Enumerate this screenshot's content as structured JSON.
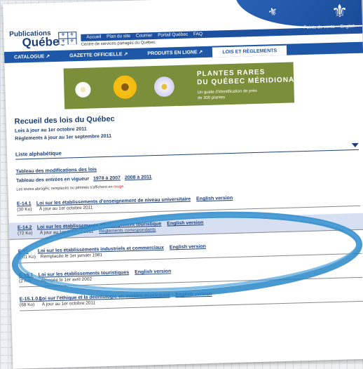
{
  "header": {
    "logo_line1": "Publications",
    "logo_line2": "Québec",
    "subtitle": "Centre de services partagés du Québec",
    "top_nav": [
      "Accueil",
      "Plan du site",
      "Courrier",
      "Portail Québec",
      "FAQ"
    ],
    "top_right": [
      "Points de vente",
      "English"
    ]
  },
  "tabs": [
    "CATALOGUE ↗",
    "GAZETTE OFFICIELLE ↗",
    "PRODUITS EN LIGNE ↗",
    "LOIS ET RÈGLEMENTS"
  ],
  "banner": {
    "title1": "PLANTES RARES",
    "title2": "DU QUÉBEC MÉRIDIONAL",
    "desc": "Un guide d'identification de près de 300 plantes"
  },
  "page": {
    "title": "Recueil des lois du Québec",
    "lois_date": "Lois à jour au 1er octobre 2011",
    "regl_date": "Règlements à jour au 1er septembre 2011",
    "liste": "Liste alphabétique",
    "tableau_modif": "Tableau des modifications des lois",
    "tableau_entrees": "Tableau des entrées en vigueur",
    "range1": "1978 à 2007",
    "range2": "2008 à 2011",
    "note_prefix": "Les textes abrogés, remplacés ou périmés s'affichent en",
    "note_red": "rouge"
  },
  "laws": [
    {
      "code": "E-14.1",
      "title": "Loi sur les établissements d'enseignement de niveau universitaire",
      "english": "English version",
      "size": "(30 Ko)",
      "status": "À jour au 1er octobre 2011",
      "extra": ""
    },
    {
      "code": "E-14.2",
      "title": "Loi sur les établissements d'hébergement touristique",
      "english": "English version",
      "size": "(72 Ko)",
      "status": "À jour au 1er octobre 2011",
      "extra": "Règlements correspondants"
    },
    {
      "code": "E-15",
      "title": "Loi sur les établissements industriels et commerciaux",
      "english": "English version",
      "size": "(101 Ko)",
      "status": "Remplacée le 1er janvier 1981",
      "extra": ""
    },
    {
      "code": "E-15.1",
      "title": "Loi sur les établissements touristiques",
      "english": "English version",
      "size": "(2 Ko)",
      "status": "Abrogée le 1er avril 2002",
      "extra": ""
    },
    {
      "code": "E-15.1.0.1",
      "title": "Loi sur l'éthique et la déontologie en matière municipale",
      "english": "English version",
      "size": "(68 Ko)",
      "status": "À jour au 1er octobre 2011",
      "extra": ""
    }
  ],
  "colors": {
    "brand": "#1e57a8",
    "text": "#1c3f76",
    "highlight": "#d6e0f2",
    "marker": "#2a86c8"
  }
}
